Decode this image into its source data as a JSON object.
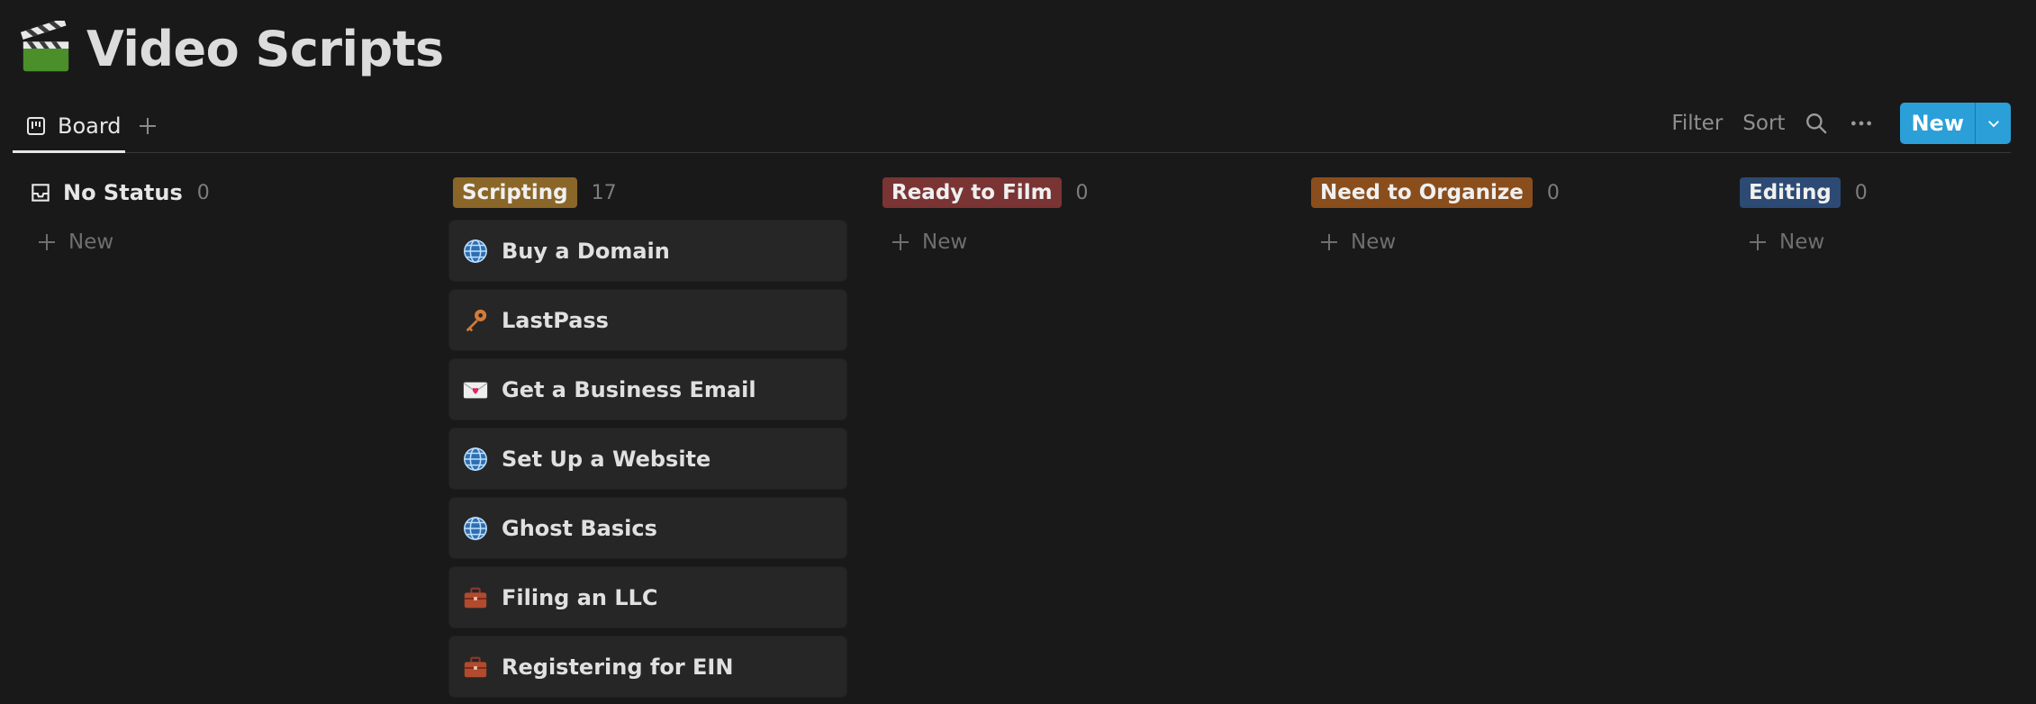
{
  "page": {
    "title": "Video Scripts",
    "icon": "clapperboard-icon"
  },
  "tabs": [
    {
      "label": "Board",
      "icon": "board-view-icon",
      "active": true
    }
  ],
  "toolbar": {
    "filter_label": "Filter",
    "sort_label": "Sort",
    "new_label": "New",
    "accent": "#2a9fd8"
  },
  "board": {
    "add_label": "New",
    "columns": [
      {
        "label": "No Status",
        "count": "0",
        "color": "",
        "icon": "inbox-icon"
      },
      {
        "label": "Scripting",
        "count": "17",
        "color": "#8a6628"
      },
      {
        "label": "Ready to Film",
        "count": "0",
        "color": "#7a3434"
      },
      {
        "label": "Need to Organize",
        "count": "0",
        "color": "#8a4e1d"
      },
      {
        "label": "Editing",
        "count": "0",
        "color": "#2c4a73"
      }
    ],
    "cards": [
      {
        "title": "Buy a Domain",
        "icon": "globe-icon"
      },
      {
        "title": "LastPass",
        "icon": "key-icon"
      },
      {
        "title": "Get a Business Email",
        "icon": "love-letter-icon"
      },
      {
        "title": "Set Up a Website",
        "icon": "globe-icon"
      },
      {
        "title": "Ghost Basics",
        "icon": "globe-icon"
      },
      {
        "title": "Filing an LLC",
        "icon": "briefcase-icon"
      },
      {
        "title": "Registering for EIN",
        "icon": "briefcase-icon"
      }
    ]
  }
}
